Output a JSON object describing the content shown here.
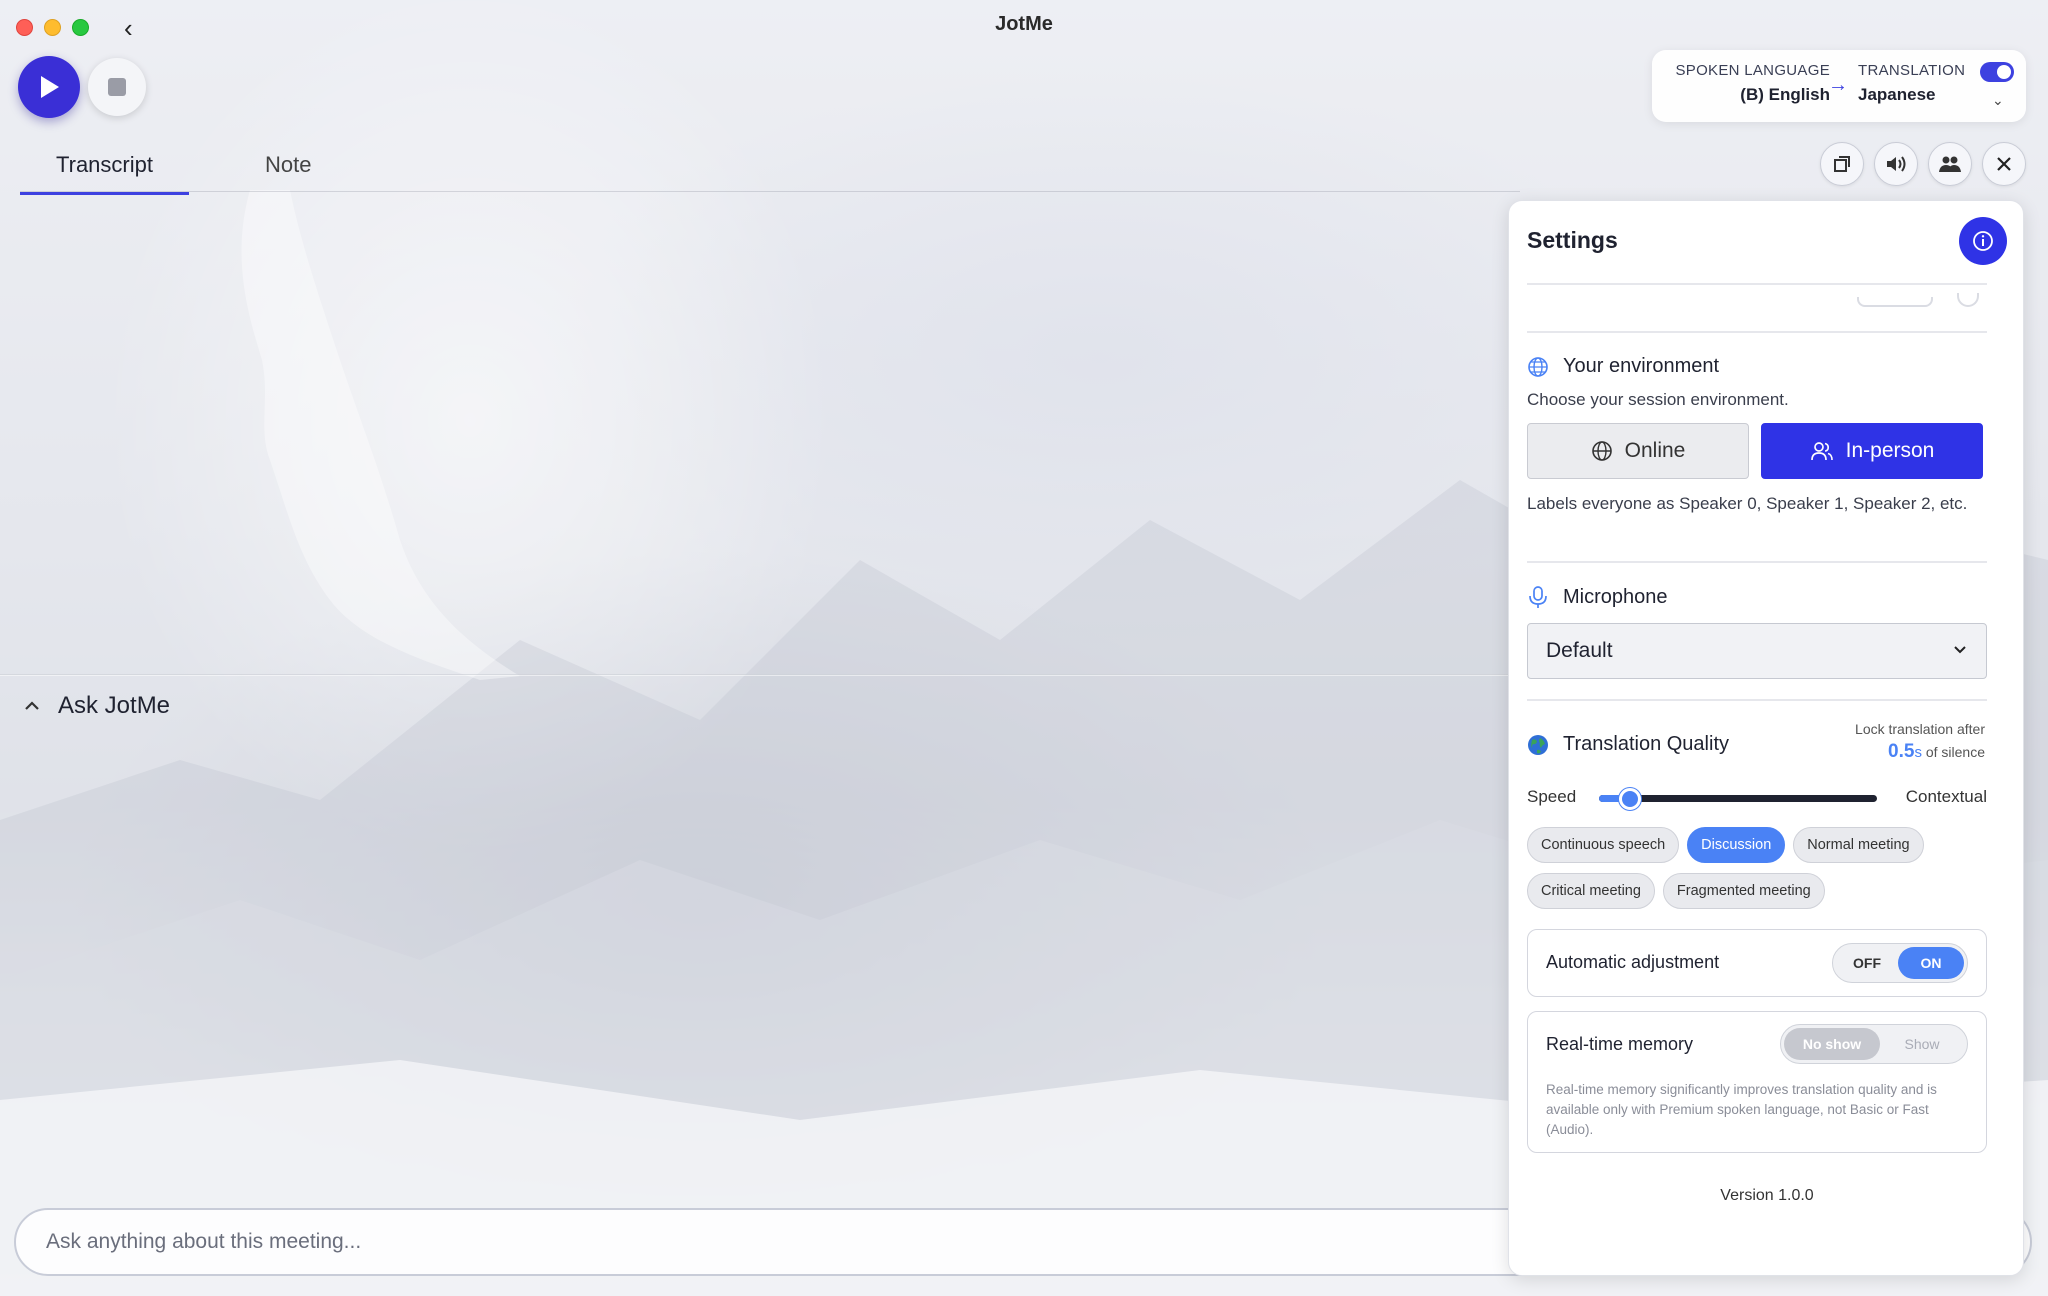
{
  "window": {
    "title": "JotMe"
  },
  "tabs": [
    {
      "label": "Transcript"
    },
    {
      "label": "Note"
    }
  ],
  "language": {
    "spoken_label": "SPOKEN LANGUAGE",
    "spoken_value": "(B) English",
    "translation_label": "TRANSLATION",
    "translation_value": "Japanese",
    "translation_enabled": true
  },
  "ask": {
    "title": "Ask JotMe",
    "placeholder": "Ask anything about this meeting..."
  },
  "settings": {
    "title": "Settings",
    "environment": {
      "title": "Your environment",
      "subtitle": "Choose your session environment.",
      "online_label": "Online",
      "inperson_label": "In-person",
      "selected": "In-person",
      "description": "Labels everyone as Speaker 0, Speaker 1, Speaker 2, etc."
    },
    "microphone": {
      "title": "Microphone",
      "selected": "Default"
    },
    "translation_quality": {
      "title": "Translation Quality",
      "lock_label": "Lock translation after",
      "lock_value": "0.5",
      "lock_unit": "s",
      "lock_suffix": "of silence",
      "slider_left": "Speed",
      "slider_right": "Contextual",
      "slider_value": 0.11,
      "presets": [
        {
          "label": "Continuous speech",
          "active": false
        },
        {
          "label": "Discussion",
          "active": true
        },
        {
          "label": "Normal meeting",
          "active": false
        },
        {
          "label": "Critical meeting",
          "active": false
        },
        {
          "label": "Fragmented meeting",
          "active": false
        }
      ]
    },
    "auto_adjust": {
      "title": "Automatic adjustment",
      "off_label": "OFF",
      "on_label": "ON",
      "value": "ON"
    },
    "memory": {
      "title": "Real-time memory",
      "noshow_label": "No show",
      "show_label": "Show",
      "value": "No show",
      "description": "Real-time memory significantly improves translation quality and is available only with Premium spoken language, not Basic or Fast (Audio)."
    },
    "version": "Version 1.0.0"
  },
  "colors": {
    "accent": "#2f33e6",
    "accent_light": "#4a82f5",
    "play": "#3a2fd6"
  }
}
